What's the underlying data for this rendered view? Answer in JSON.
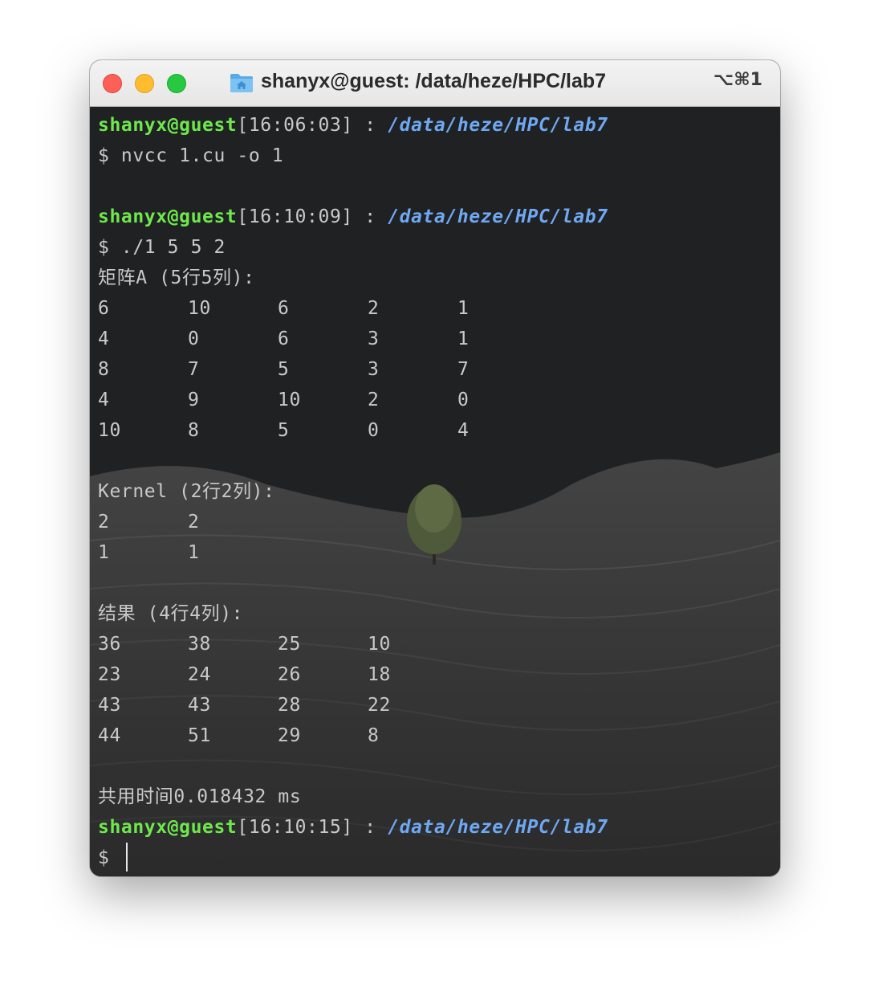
{
  "window": {
    "title": "shanyx@guest: /data/heze/HPC/lab7",
    "shortcut": "⌥⌘1"
  },
  "terminal": {
    "prompt1": {
      "user": "shanyx@guest",
      "time": "[16:06:03]",
      "sep": " : ",
      "path": "/data/heze/HPC/lab7"
    },
    "cmd1": "$ nvcc 1.cu -o 1",
    "prompt2": {
      "user": "shanyx@guest",
      "time": "[16:10:09]",
      "sep": " : ",
      "path": "/data/heze/HPC/lab7"
    },
    "cmd2": "$ ./1 5 5 2",
    "matrix_a_header": "矩阵A (5行5列):",
    "matrix_a": [
      [
        "6",
        "10",
        "6",
        "2",
        "1"
      ],
      [
        "4",
        "0",
        "6",
        "3",
        "1"
      ],
      [
        "8",
        "7",
        "5",
        "3",
        "7"
      ],
      [
        "4",
        "9",
        "10",
        "2",
        "0"
      ],
      [
        "10",
        "8",
        "5",
        "0",
        "4"
      ]
    ],
    "kernel_header": "Kernel (2行2列):",
    "kernel": [
      [
        "2",
        "2"
      ],
      [
        "1",
        "1"
      ]
    ],
    "result_header": "结果 (4行4列):",
    "result": [
      [
        "36",
        "38",
        "25",
        "10"
      ],
      [
        "23",
        "24",
        "26",
        "18"
      ],
      [
        "43",
        "43",
        "28",
        "22"
      ],
      [
        "44",
        "51",
        "29",
        "8"
      ]
    ],
    "time_line": "共用时间0.018432 ms",
    "prompt3": {
      "user": "shanyx@guest",
      "time": "[16:10:15]",
      "sep": " : ",
      "path": "/data/heze/HPC/lab7"
    },
    "cmd3": "$ "
  },
  "colors": {
    "user": "#6ee84d",
    "path": "#6fa8f3",
    "text": "#c9c9c9",
    "background": "#202122"
  },
  "icons": {
    "close": "close-icon",
    "minimize": "minimize-icon",
    "maximize": "maximize-icon",
    "folder": "home-folder-icon"
  }
}
